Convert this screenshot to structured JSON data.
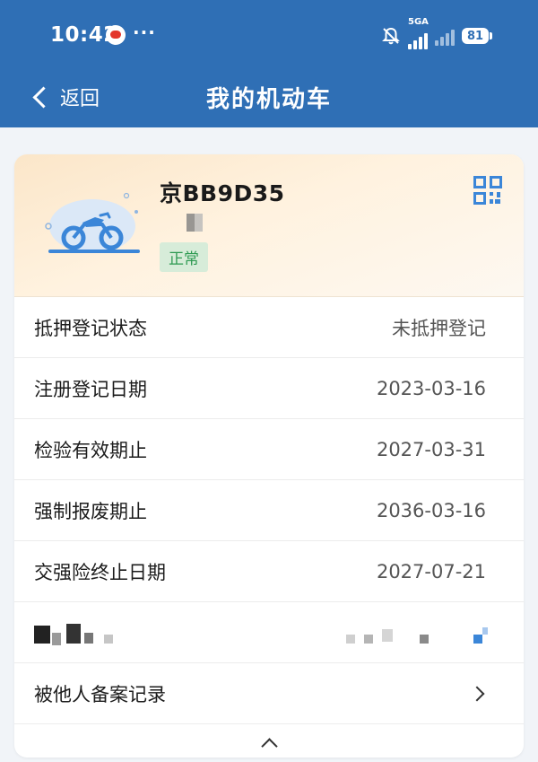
{
  "status_bar": {
    "time": "10:42",
    "dots": "···",
    "network": "5GA",
    "battery": "81",
    "icons": [
      "bell-off-icon",
      "signal-icon",
      "signal-weak-icon",
      "battery-icon"
    ]
  },
  "nav": {
    "back_label": "返回",
    "title": "我的机动车"
  },
  "vehicle": {
    "plate": "京BB9D35",
    "status": "正常",
    "icon": "motorcycle-icon"
  },
  "info_rows": [
    {
      "label": "抵押登记状态",
      "value": "未抵押登记"
    },
    {
      "label": "注册登记日期",
      "value": "2023-03-16"
    },
    {
      "label": "检验有效期止",
      "value": "2027-03-31"
    },
    {
      "label": "强制报废期止",
      "value": "2036-03-16"
    },
    {
      "label": "交强险终止日期",
      "value": "2027-07-21"
    }
  ],
  "records_link": {
    "label": "被他人备案记录"
  },
  "colors": {
    "header_blue": "#2f6fb5",
    "accent_blue": "#3b86d8",
    "status_green": "#2e9a52",
    "card_gradient_start": "#fbe6c9"
  }
}
